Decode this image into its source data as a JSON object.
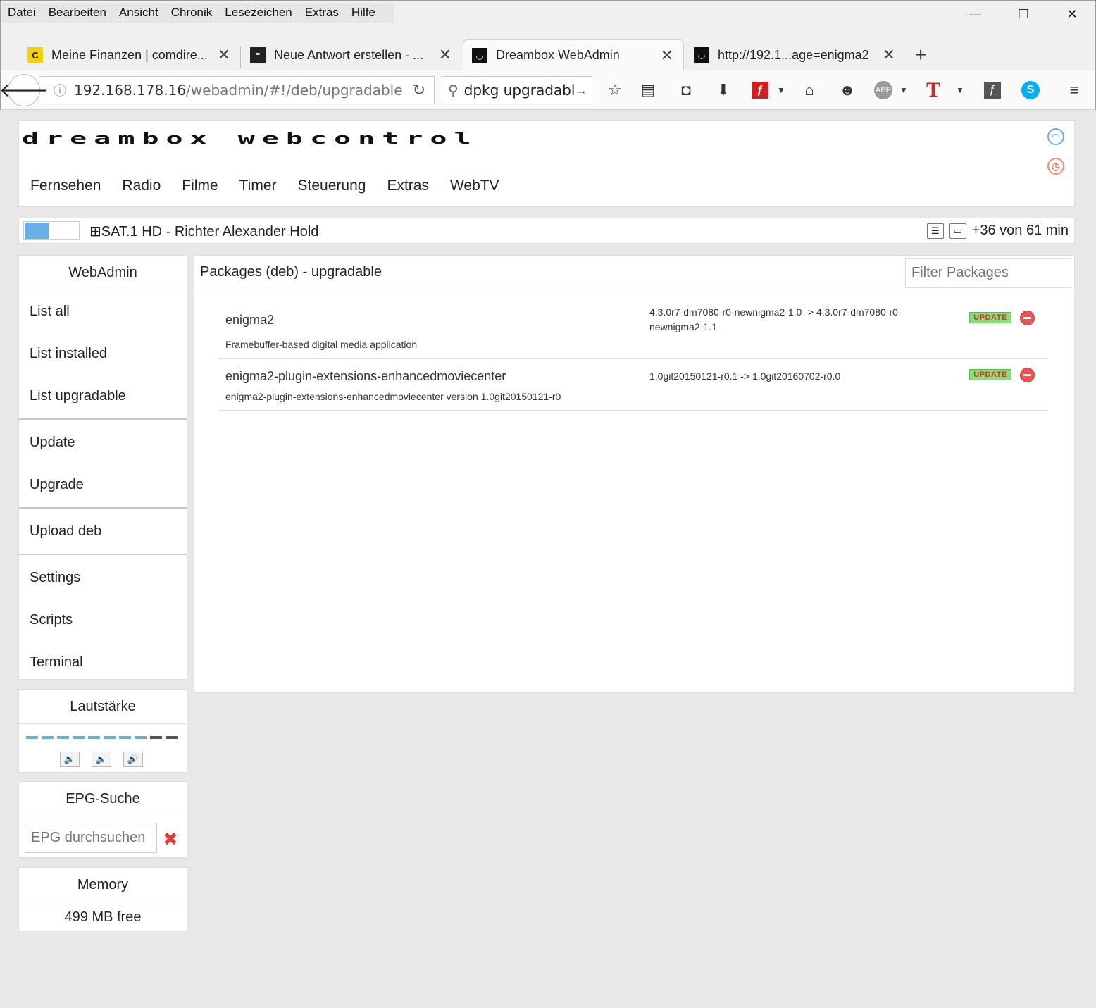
{
  "menubar": [
    "Datei",
    "Bearbeiten",
    "Ansicht",
    "Chronik",
    "Lesezeichen",
    "Extras",
    "Hilfe"
  ],
  "window_controls": {
    "minimize": "—",
    "maximize": "☐",
    "close": "✕"
  },
  "tabs": [
    {
      "title": "Meine Finanzen | comdire...",
      "icon": "comdirect-icon",
      "active": false
    },
    {
      "title": "Neue Antwort erstellen - ...",
      "icon": "forum-icon",
      "active": false
    },
    {
      "title": "Dreambox WebAdmin",
      "icon": "dreambox-icon",
      "active": true
    },
    {
      "title": "http://192.1...age=enigma2",
      "icon": "dreambox-icon",
      "active": false
    }
  ],
  "navbar": {
    "url_host": "192.168.178.16",
    "url_path": "/webadmin/#!/deb/upgradable",
    "search_query": "dpkg upgradabl"
  },
  "header": {
    "logo": "dreambox webcontrol",
    "nav": [
      "Fernsehen",
      "Radio",
      "Filme",
      "Timer",
      "Steuerung",
      "Extras",
      "WebTV"
    ]
  },
  "now_playing": {
    "title": "⊞SAT.1 HD - Richter Alexander Hold",
    "remaining": "+36 von 61 min",
    "progress": 0.43
  },
  "sidebar": {
    "title": "WebAdmin",
    "groups": [
      [
        "List all",
        "List installed",
        "List upgradable"
      ],
      [
        "Update",
        "Upgrade"
      ],
      [
        "Upload deb"
      ],
      [
        "Settings",
        "Scripts",
        "Terminal"
      ]
    ]
  },
  "volume": {
    "title": "Lautstärke",
    "level": 8,
    "max": 10,
    "active_color": "#6aaee8",
    "inactive_color": "#555555"
  },
  "epg": {
    "title": "EPG-Suche",
    "placeholder": "EPG durchsuchen"
  },
  "memory": {
    "title": "Memory",
    "value": "499 MB free"
  },
  "content": {
    "title": "Packages (deb) - upgradable",
    "filter_placeholder": "Filter Packages",
    "update_label": "UPDATE",
    "packages": [
      {
        "name": "enigma2",
        "description": "Framebuffer-based digital media application",
        "version": "4.3.0r7-dm7080-r0-newnigma2-1.0 -> 4.3.0r7-dm7080-r0-newnigma2-1.1"
      },
      {
        "name": "enigma2-plugin-extensions-enhancedmoviecenter",
        "description": "enigma2-plugin-extensions-enhancedmoviecenter version 1.0git20150121-r0",
        "version": "1.0git20150121-r0.1 -> 1.0git20160702-r0.0"
      }
    ]
  }
}
